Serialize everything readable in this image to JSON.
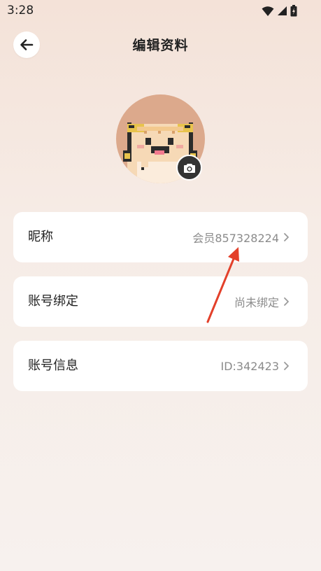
{
  "status_bar": {
    "time": "3:28",
    "icons": [
      "wifi-icon",
      "signal-icon",
      "battery-icon"
    ]
  },
  "header": {
    "title": "编辑资料",
    "back_icon": "arrow-left-icon"
  },
  "avatar": {
    "camera_icon": "camera-icon"
  },
  "profile_items": [
    {
      "label": "昵称",
      "value": "会员857328224"
    },
    {
      "label": "账号绑定",
      "value": "尚未绑定"
    },
    {
      "label": "账号信息",
      "value": "ID:342423"
    }
  ],
  "colors": {
    "annotation_arrow": "#e3402a",
    "avatar_bg": "#dca98c"
  }
}
